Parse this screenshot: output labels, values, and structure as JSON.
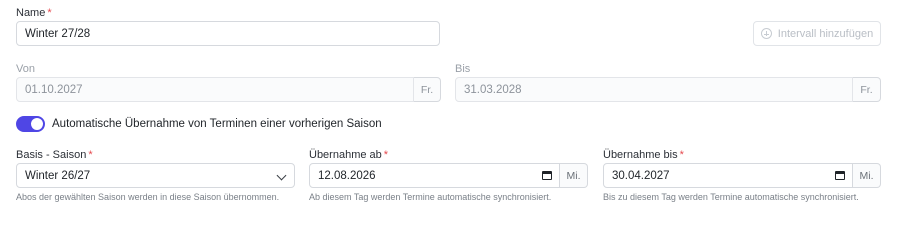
{
  "name": {
    "label": "Name",
    "value": "Winter 27/28"
  },
  "interval_button": {
    "label": "Intervall hinzufügen"
  },
  "von": {
    "label": "Von",
    "value": "01.10.2027",
    "weekday": "Fr."
  },
  "bis": {
    "label": "Bis",
    "value": "31.03.2028",
    "weekday": "Fr."
  },
  "auto_takeover": {
    "label": "Automatische Übernahme von Terminen einer vorherigen Saison",
    "enabled": true
  },
  "basis_saison": {
    "label": "Basis - Saison",
    "value": "Winter 26/27",
    "help": "Abos der gewählten Saison werden in diese Saison übernommen."
  },
  "uebernahme_ab": {
    "label": "Übernahme ab",
    "value": "12.08.2026",
    "weekday": "Mi.",
    "help": "Ab diesem Tag werden Termine automatische synchronisiert."
  },
  "uebernahme_bis": {
    "label": "Übernahme bis",
    "value": "30.04.2027",
    "weekday": "Mi.",
    "help": "Bis zu diesem Tag werden Termine automatische synchronisiert."
  },
  "required_mark": "*",
  "colors": {
    "accent": "#4f46e5",
    "required": "#e5484d"
  }
}
